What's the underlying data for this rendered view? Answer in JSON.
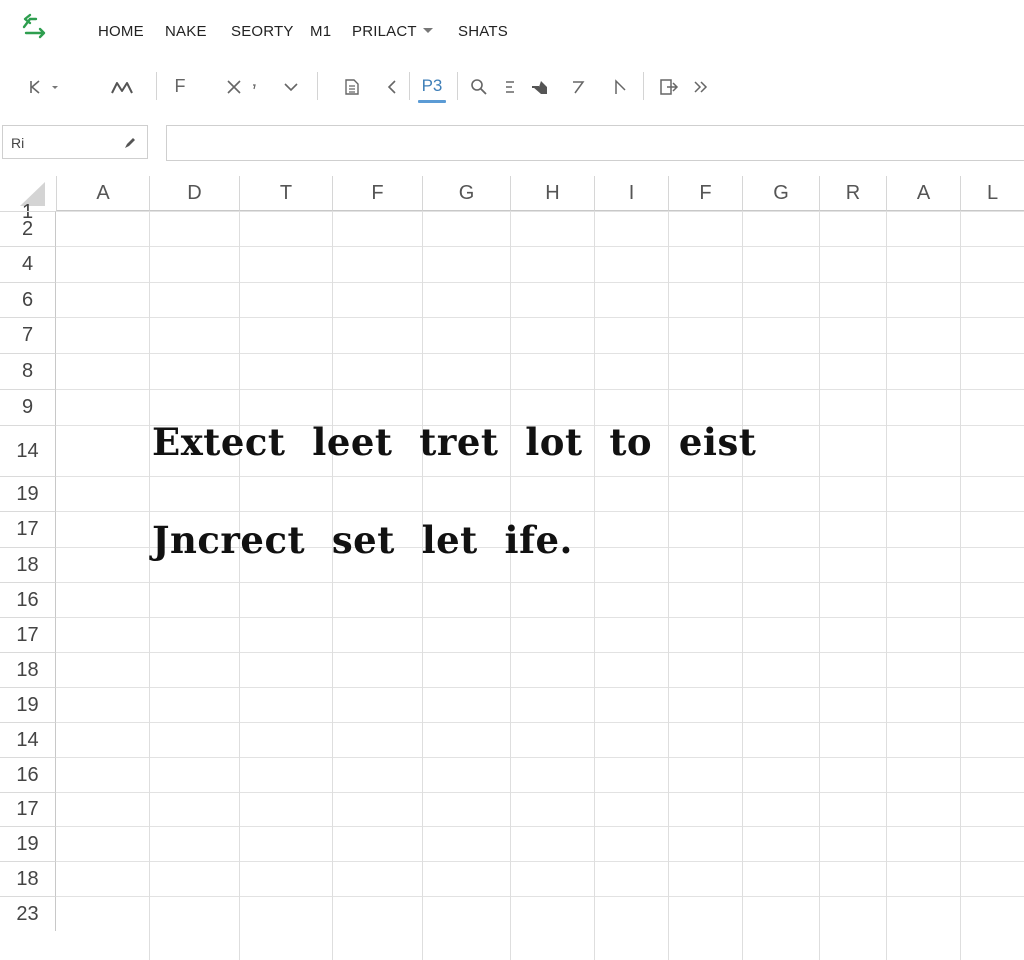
{
  "menu": {
    "items": [
      "HOME",
      "NAKE",
      "SEORTY",
      "M1",
      "PRILACT",
      "SHATS"
    ]
  },
  "toolbar": {
    "font_glyph": "F",
    "active_label": "P3"
  },
  "namebox": {
    "value": "Ri"
  },
  "formula": {
    "value": ""
  },
  "columns": [
    "A",
    "D",
    "T",
    "F",
    "G",
    "H",
    "I",
    "F",
    "G",
    "R",
    "A",
    "L"
  ],
  "rows": [
    "1",
    "2",
    "4",
    "6",
    "7",
    "8",
    "9",
    "14",
    "19",
    "17",
    "18",
    "16",
    "17",
    "18",
    "19",
    "14",
    "16",
    "17",
    "19",
    "18",
    "23"
  ],
  "cells": {
    "line1": "Extect  leet  tret  lot  to  eist",
    "line2": "Jncrect  set  let  ife."
  },
  "colors": {
    "accent": "#5b9bd5",
    "logo": "#2e9e4f"
  }
}
